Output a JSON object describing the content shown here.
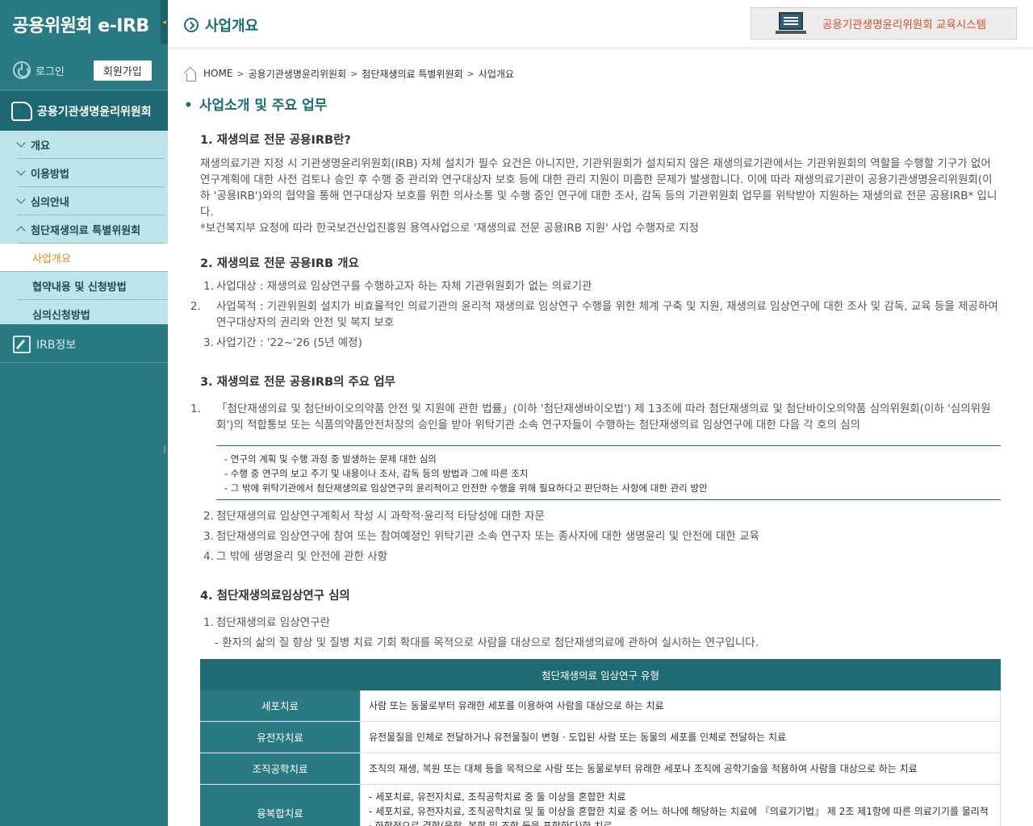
{
  "sidebar": {
    "brand": "공용위원회 e-IRB",
    "collapse": "◂",
    "login": "로그인",
    "signup": "회원가입",
    "main_menu": "공용기관생명윤리위원회",
    "items": [
      {
        "label": "개요"
      },
      {
        "label": "이용방법"
      },
      {
        "label": "심의안내"
      },
      {
        "label": "첨단재생의료 특별위원회"
      }
    ],
    "subitems": [
      {
        "label": "사업개요"
      },
      {
        "label": "협약내용 및 신청방법"
      },
      {
        "label": "심의신청방법"
      }
    ],
    "irb_info": "IRB정보"
  },
  "header": {
    "title": "사업개요",
    "edu_system": "공용기관생명윤리위원회 교육시스템"
  },
  "breadcrumb": [
    "HOME",
    "공용기관생명윤리위원회",
    "첨단재생의료 특별위원회",
    "사업개요"
  ],
  "content": {
    "section_title": "사업소개 및 주요 업무",
    "s1": {
      "title": "1. 재생의료 전문 공용IRB란?",
      "body": "재생의료기관 지정 시 기관생명윤리위원회(IRB) 자체 설치가 필수 요건은 아니지만, 기관위원회가 설치되지 않은 재생의료기관에서는 기관위원회의 역할을 수행할 기구가 없어 연구계획에 대한 사전 검토나 승인 후 수행 중 관리와 연구대상자 보호 등에 대한 관리 지원이 미흡한 문제가 발생합니다. 이에 따라 재생의료기관이 공용기관생명윤리위원회(이하 '공용IRB')와의 협약을 통해 연구대상자 보호를 위한 의사소통 및 수행 중인 연구에 대한 조사, 감독 등의 기관위원회 업무를 위탁받아 지원하는 재생의료 전문 공용IRB* 입니다.",
      "note": "*보건복지부 요청에 따라 한국보건산업진흥원 용역사업으로 '재생의료 전문 공용IRB 지원' 사업 수행자로 지정"
    },
    "s2": {
      "title": "2. 재생의료 전문 공용IRB 개요",
      "items": [
        {
          "num": "1.",
          "text": "사업대상 : 재생의료 임상연구를 수행하고자 하는 자체 기관위원회가 없는 의료기관"
        },
        {
          "num": "2.",
          "text": "사업목적 : 기관위원회 설치가 비효율적인 의료기관의 윤리적 재생의료 임상연구 수행을 위한 체계 구축 및 지원, 재생의료 임상연구에 대한 조사 및 감독, 교육 등을 제공하여 연구대상자의 권리와 안전 및 복지 보호"
        },
        {
          "num": "3.",
          "text": "사업기간 : '22~'26 (5년 예정)"
        }
      ]
    },
    "s3": {
      "title": "3. 재생의료 전문 공용IRB의 주요 업무",
      "item1": {
        "num": "1.",
        "text": "「첨단재생의료 및 첨단바이오의약품 안전 및 지원에 관한 법률」(이하 '첨단재생바이오법') 제 13조에 따라 첨단재생의료 및 첨단바이오의약품 심의위원회(이하 '심의위원회')의 적합통보 또는 식품의약품안전처장의 승인을 받아 위탁기관 소속 연구자들이 수행하는 첨단재생의료 임상연구에 대한 다음 각 호의 심의"
      },
      "box": [
        "- 연구의 계획 및 수행 과정 중 발생하는 문제 대한 심의",
        "- 수행 중 연구의 보고 주기 및 내용이나 조사, 감독 등의 방법과 그에 따른 조치",
        "- 그 밖에 위탁기관에서 첨단재생의료 임상연구의 윤리적이고 안전한 수행을 위해 필요하다고 판단하는 사항에 대한 관리 방안"
      ],
      "items": [
        {
          "num": "2.",
          "text": "첨단재생의료 임상연구계획서 작성 시 과학적·윤리적 타당성에 대한 자문"
        },
        {
          "num": "3.",
          "text": "첨단재생의료 임상연구에 참여 또는 참여예정인 위탁기관 소속 연구자 또는 종사자에 대한 생명윤리 및 안전에 대한 교육"
        },
        {
          "num": "4.",
          "text": "그 밖에 생명윤리 및 안전에 관한 사항"
        }
      ]
    },
    "s4": {
      "title": "4. 첨단재생의료임상연구 심의",
      "item1": {
        "num": "1.",
        "text": "첨단재생의료 임상연구란"
      },
      "desc": "- 환자의 삶의 질 향상 및 질병 치료 기회 확대를 목적으로 사람을 대상으로 첨단재생의료에 관하여 실시하는 연구입니다.",
      "table": {
        "header": "첨단재생의료 임상연구 유형",
        "rows": [
          {
            "type": "세포치료",
            "desc": "사람 또는 동물로부터 유래한 세포를 이용하여 사람을 대상으로 하는 치료"
          },
          {
            "type": "유전자치료",
            "desc": "유전물질을 인체로 전달하거나 유전물질이 변형 · 도입된 사람 또는 동물의 세포를 인체로 전달하는 치료"
          },
          {
            "type": "조직공학치료",
            "desc": "조직의 재생, 복원 또는 대체 등을 목적으로 사람 또는 동물로부터 유래한 세포나 조직에 공학기술을 적용하여 사람을 대상으로 하는 치료"
          },
          {
            "type": "융복합치료",
            "desc1": "- 세포치료, 유전자치료, 조직공학치료 중 둘 이상을 혼합한 치료",
            "desc2": "- 세포치료, 유전자치료, 조직공학치료 및 둘 이상을 혼합한 치료 중 어느 하나에 해당하는 치료에 『의료기기법』 제 2조 제1항에 따른 의료기기를 물리적 · 화학적으로 결합(융합, 복합 및 조합 등을 포함한다)한 치료"
          }
        ]
      }
    }
  }
}
